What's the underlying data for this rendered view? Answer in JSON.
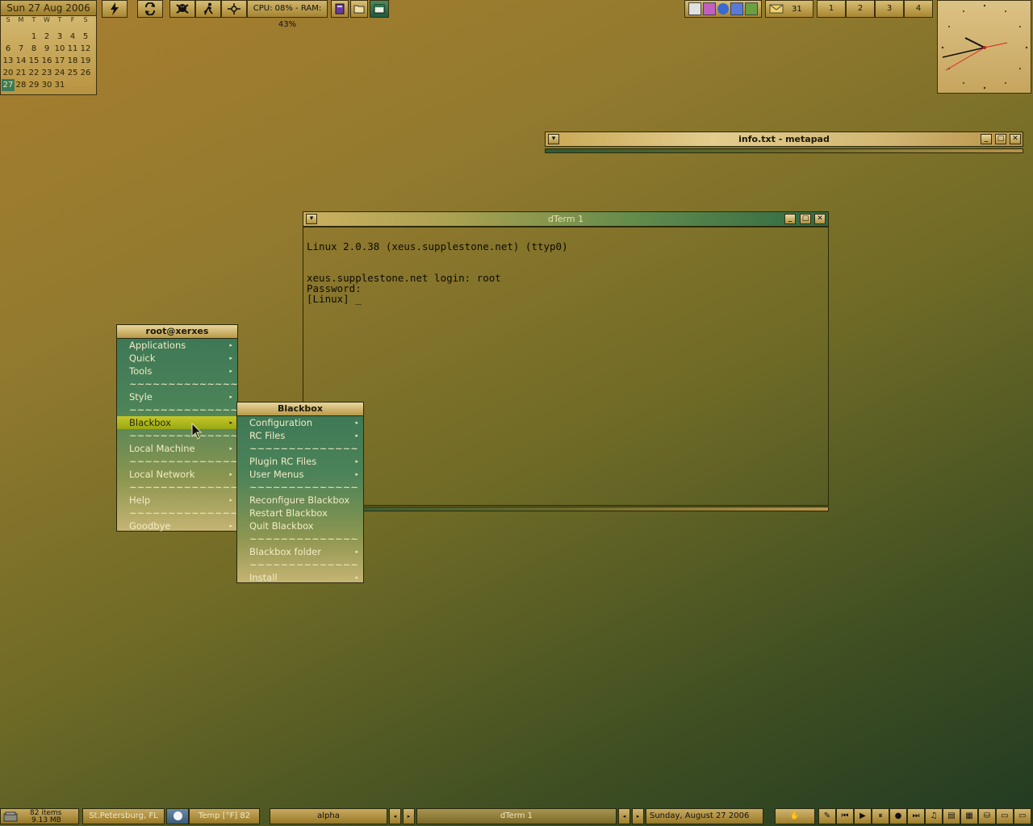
{
  "calendar": {
    "header": "Sun 27 Aug 2006",
    "dow": [
      "S",
      "M",
      "T",
      "W",
      "T",
      "F",
      "S"
    ],
    "weeks": [
      [
        "",
        "",
        "1",
        "2",
        "3",
        "4",
        "5"
      ],
      [
        "6",
        "7",
        "8",
        "9",
        "10",
        "11",
        "12"
      ],
      [
        "13",
        "14",
        "15",
        "16",
        "17",
        "18",
        "19"
      ],
      [
        "20",
        "21",
        "22",
        "23",
        "24",
        "25",
        "26"
      ],
      [
        "27",
        "28",
        "29",
        "30",
        "31",
        "",
        ""
      ]
    ],
    "today": "27"
  },
  "toolbar": {
    "cpu_ram": "CPU: 08% - RAM: 43%",
    "mail_count": "31",
    "workspaces": [
      "1",
      "2",
      "3",
      "4"
    ]
  },
  "metapad": {
    "title": "info.txt - metapad"
  },
  "dterm": {
    "title": "dTerm 1",
    "lines": [
      "Linux 2.0.38 (xeus.supplestone.net) (ttyp0)",
      "",
      "",
      "xeus.supplestone.net login: root",
      "Password:",
      "[Linux] _"
    ]
  },
  "root_menu": {
    "title": "root@xerxes",
    "items": [
      {
        "label": "Applications",
        "submenu": true
      },
      {
        "label": "Quick",
        "submenu": true
      },
      {
        "label": "Tools",
        "submenu": true
      },
      {
        "label": "~~~~~~~~~~~~~~",
        "submenu": false
      },
      {
        "label": "Style",
        "submenu": true
      },
      {
        "label": "~~~~~~~~~~~~~~",
        "submenu": false
      },
      {
        "label": "Blackbox",
        "submenu": true,
        "selected": true
      },
      {
        "label": "~~~~~~~~~~~~~~",
        "submenu": false
      },
      {
        "label": "Local Machine",
        "submenu": true
      },
      {
        "label": "~~~~~~~~~~~~~~",
        "submenu": false
      },
      {
        "label": "Local Network",
        "submenu": true
      },
      {
        "label": "~~~~~~~~~~~~~~",
        "submenu": false
      },
      {
        "label": "Help",
        "submenu": true
      },
      {
        "label": "~~~~~~~~~~~~~~",
        "submenu": false
      },
      {
        "label": "Goodbye",
        "submenu": true
      }
    ]
  },
  "blackbox_menu": {
    "title": "Blackbox",
    "items": [
      {
        "label": "Configuration",
        "submenu": true
      },
      {
        "label": "RC Files",
        "submenu": true
      },
      {
        "label": "~~~~~~~~~~~~~~",
        "submenu": false
      },
      {
        "label": "Plugin RC Files",
        "submenu": true
      },
      {
        "label": "User Menus",
        "submenu": true
      },
      {
        "label": "~~~~~~~~~~~~~~",
        "submenu": false
      },
      {
        "label": "Reconfigure Blackbox",
        "submenu": false
      },
      {
        "label": "Restart Blackbox",
        "submenu": false
      },
      {
        "label": "Quit Blackbox",
        "submenu": false
      },
      {
        "label": "~~~~~~~~~~~~~~",
        "submenu": false
      },
      {
        "label": "Blackbox folder",
        "submenu": true
      },
      {
        "label": "~~~~~~~~~~~~~~",
        "submenu": false
      },
      {
        "label": "Install",
        "submenu": true
      }
    ]
  },
  "bottom_bar": {
    "recycle_items": "82 items",
    "recycle_size": "9.13 MB",
    "weather_location": "St.Petersburg, FL",
    "temperature": "Temp [°F] 82",
    "workspace_name": "alpha",
    "active_task": "dTerm 1",
    "date": "Sunday, August 27 2006"
  }
}
